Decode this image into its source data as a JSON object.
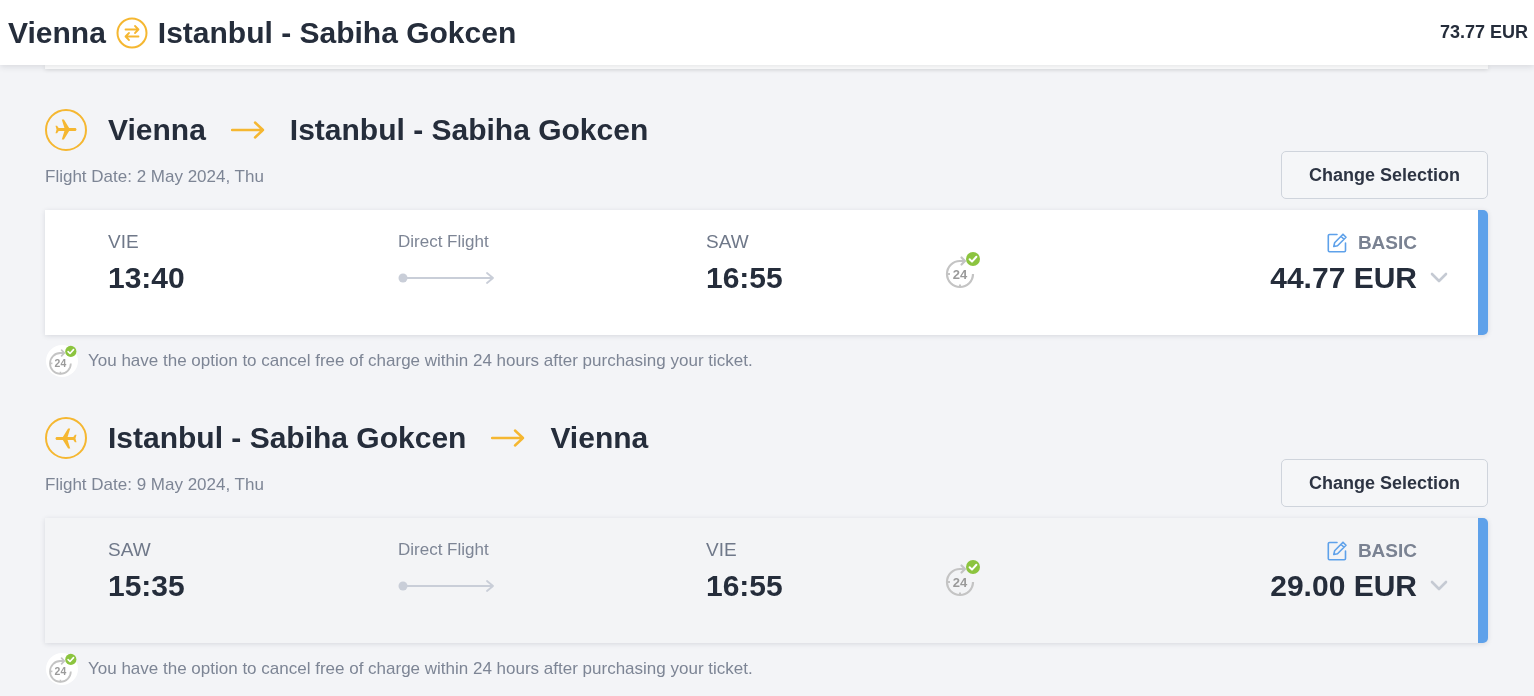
{
  "header": {
    "origin": "Vienna",
    "destination": "Istanbul - Sabiha Gokcen",
    "total_price": "73.77 EUR"
  },
  "legs": [
    {
      "kind": "outbound",
      "origin": "Vienna",
      "destination": "Istanbul - Sabiha Gokcen",
      "flight_date": "Flight Date: 2 May 2024, Thu",
      "change_button": "Change Selection",
      "flight": {
        "highlighted": true,
        "expanded": false,
        "departure_code": "VIE",
        "departure_time": "13:40",
        "stops": "Direct Flight",
        "arrival_code": "SAW",
        "arrival_time": "16:55",
        "cancel_icon_text": "24",
        "fare": "BASIC",
        "price": "44.77 EUR"
      },
      "notice": {
        "icon_text": "24",
        "text": "You have the option to cancel free of charge within 24 hours after purchasing your ticket."
      }
    },
    {
      "kind": "return",
      "origin": "Istanbul - Sabiha Gokcen",
      "destination": "Vienna",
      "flight_date": "Flight Date: 9 May 2024, Thu",
      "change_button": "Change Selection",
      "flight": {
        "highlighted": false,
        "expanded": false,
        "departure_code": "SAW",
        "departure_time": "15:35",
        "stops": "Direct Flight",
        "arrival_code": "VIE",
        "arrival_time": "16:55",
        "cancel_icon_text": "24",
        "fare": "BASIC",
        "price": "29.00 EUR"
      },
      "notice": {
        "icon_text": "24",
        "text": "You have the option to cancel free of charge within 24 hours after purchasing your ticket."
      }
    }
  ]
}
